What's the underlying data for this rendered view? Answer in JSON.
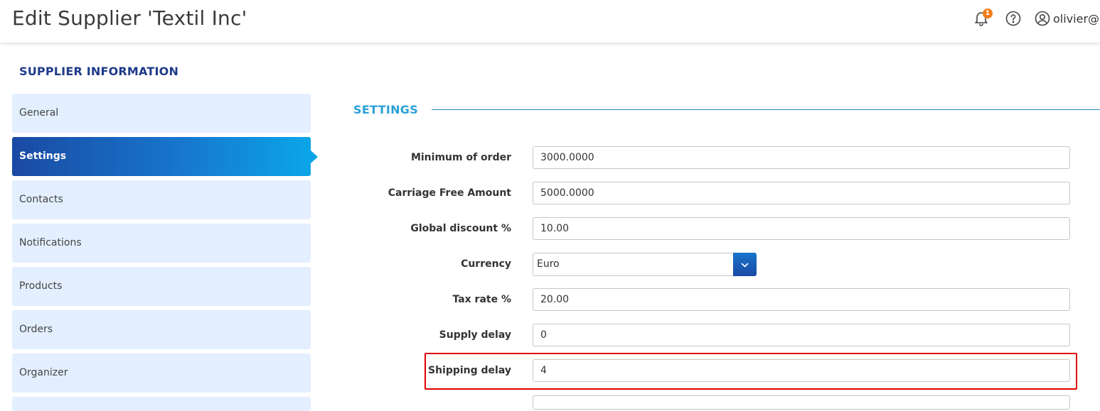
{
  "header": {
    "title": "Edit Supplier 'Textil Inc'",
    "notification_count": "1",
    "user_email": "olivier@l",
    "icons": [
      "bell-icon",
      "help-icon",
      "user-icon"
    ]
  },
  "sidebar": {
    "section_title": "SUPPLIER INFORMATION",
    "items": [
      {
        "label": "General",
        "active": false
      },
      {
        "label": "Settings",
        "active": true
      },
      {
        "label": "Contacts",
        "active": false
      },
      {
        "label": "Notifications",
        "active": false
      },
      {
        "label": "Products",
        "active": false
      },
      {
        "label": "Orders",
        "active": false
      },
      {
        "label": "Organizer",
        "active": false
      }
    ]
  },
  "settings": {
    "title": "SETTINGS",
    "fields": [
      {
        "label": "Minimum of order",
        "value": "3000.0000"
      },
      {
        "label": "Carriage Free Amount",
        "value": "5000.0000"
      },
      {
        "label": "Global discount %",
        "value": "10.00"
      },
      {
        "label": "Currency",
        "value": "Euro"
      },
      {
        "label": "Tax rate %",
        "value": "20.00"
      },
      {
        "label": "Supply delay",
        "value": "0"
      },
      {
        "label": "Shipping delay",
        "value": "4"
      }
    ]
  },
  "colors": {
    "accent_blue": "#1a4aa3",
    "accent_light": "#0aa5e8",
    "nav_bg": "#e3efff",
    "badge": "#f07d1a",
    "highlight": "#e00000",
    "section_title": "#1e3a8a"
  }
}
